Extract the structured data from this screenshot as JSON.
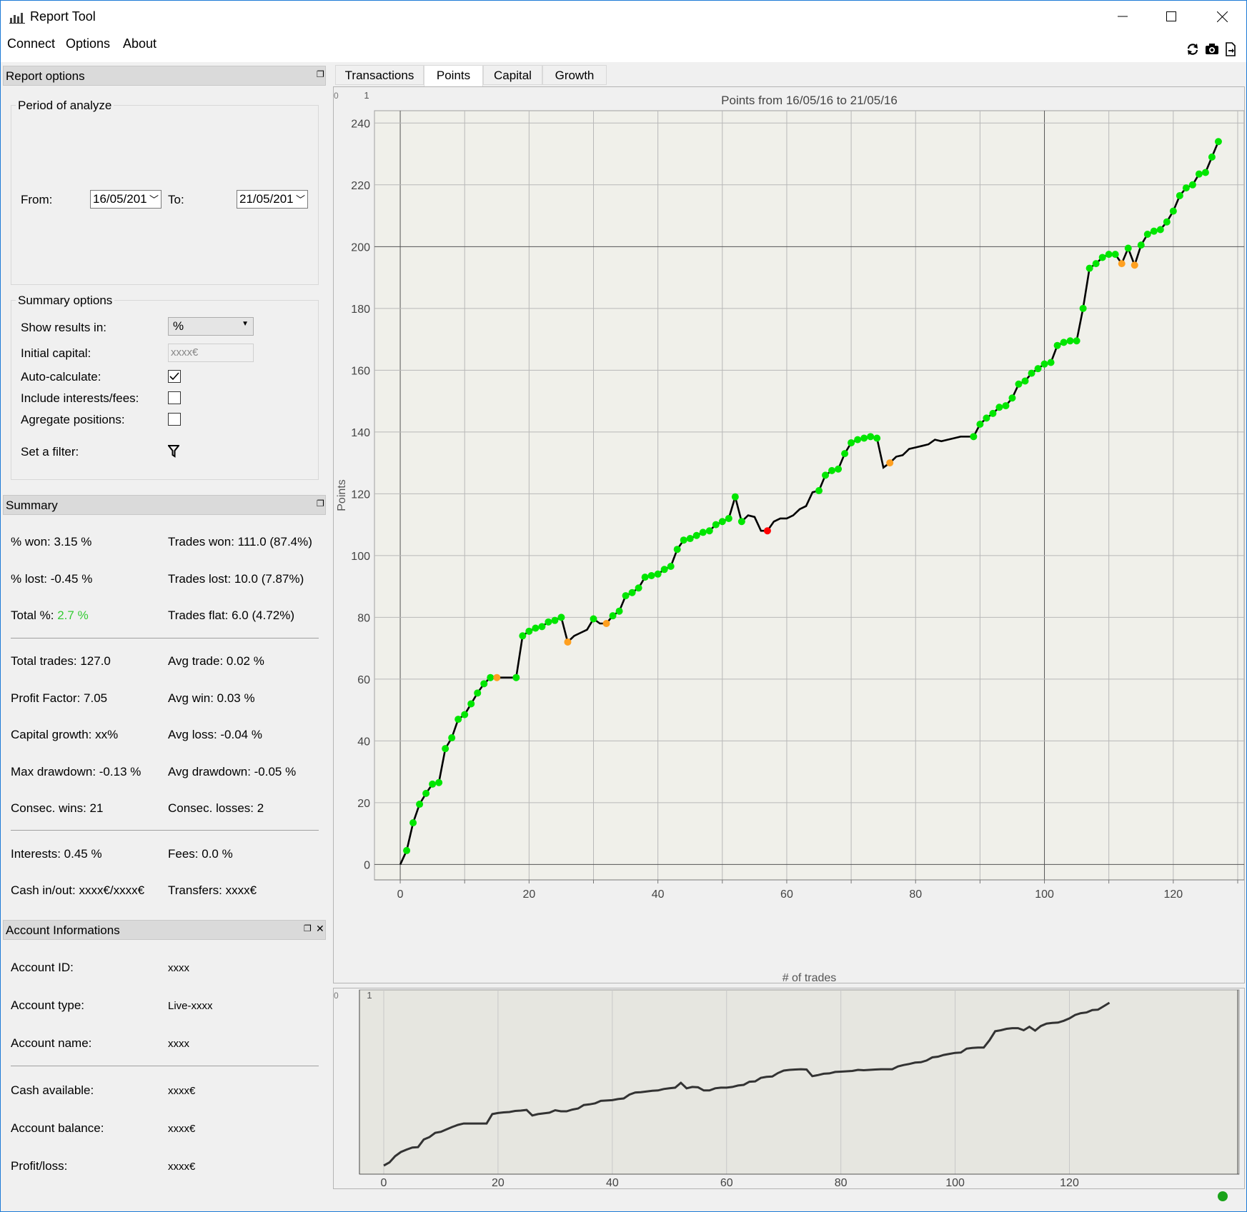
{
  "app": {
    "title": "Report Tool"
  },
  "menu": {
    "items": [
      "Connect",
      "Options",
      "About"
    ]
  },
  "toolbar": {
    "icons": [
      "refresh-icon",
      "camera-icon",
      "export-icon"
    ]
  },
  "report_options": {
    "title": "Report options",
    "period_group": "Period of analyze",
    "from_label": "From:",
    "from_value": "16/05/201",
    "to_label": "To:",
    "to_value": "21/05/201",
    "summary_group": "Summary options",
    "show_results_label": "Show results in:",
    "show_results_value": "%",
    "initial_capital_label": "Initial capital:",
    "initial_capital_placeholder": "xxxx€",
    "auto_calculate_label": "Auto-calculate:",
    "auto_calculate": true,
    "include_interests_label": "Include interests/fees:",
    "include_interests": false,
    "aggregate_label": "Agregate positions:",
    "aggregate": false,
    "filter_label": "Set a filter:"
  },
  "summary": {
    "title": "Summary",
    "won_pct_label": "% won:",
    "won_pct": "3.15 %",
    "lost_pct_label": "% lost:",
    "lost_pct": "-0.45 %",
    "total_pct_label": "Total %:",
    "total_pct": "2.7 %",
    "trades_won": "Trades won: 111.0 (87.4%)",
    "trades_lost": "Trades lost: 10.0 (7.87%)",
    "trades_flat": "Trades flat: 6.0 (4.72%)",
    "total_trades": "Total trades: 127.0",
    "avg_trade": "Avg trade: 0.02 %",
    "profit_factor": "Profit Factor: 7.05",
    "avg_win": "Avg win: 0.03 %",
    "capital_growth": "Capital growth: xx%",
    "avg_loss": "Avg loss: -0.04 %",
    "max_drawdown": "Max drawdown: -0.13 %",
    "avg_drawdown": "Avg drawdown: -0.05 %",
    "consec_wins": "Consec. wins: 21",
    "consec_losses": "Consec. losses: 2",
    "interests": "Interests: 0.45 %",
    "fees": "Fees: 0.0 %",
    "cash_inout": "Cash in/out: xxxx€/xxxx€",
    "transfers": "Transfers: xxxx€",
    "positive_color": "#33cc33"
  },
  "account": {
    "title": "Account Informations",
    "rows": [
      {
        "label": "Account ID:",
        "value": "xxxx"
      },
      {
        "label": "Account type:",
        "value": "Live-xxxx"
      },
      {
        "label": "Account name:",
        "value": "xxxx"
      },
      {
        "label": "Cash available:",
        "value": "xxxx€"
      },
      {
        "label": "Account balance:",
        "value": "xxxx€"
      },
      {
        "label": "Profit/loss:",
        "value": "xxxx€"
      }
    ]
  },
  "tabs": [
    "Transactions",
    "Points",
    "Capital",
    "Growth"
  ],
  "active_tab": "Points",
  "chart_data": {
    "type": "scatter",
    "title": "Points from 16/05/16 to 21/05/16",
    "xlabel": "# of trades",
    "ylabel": "Points",
    "xlim": [
      -4,
      131
    ],
    "ylim": [
      -5,
      244
    ],
    "xticks": [
      0,
      20,
      40,
      60,
      80,
      100,
      120
    ],
    "yticks": [
      0,
      20,
      40,
      60,
      80,
      100,
      120,
      140,
      160,
      180,
      200,
      220,
      240
    ],
    "corner_labels": [
      "0",
      "1"
    ],
    "grid": true,
    "line_color": "#000000",
    "colors": {
      "win": "#00e600",
      "flat": "#ffa020",
      "loss": "#ff0000"
    },
    "x": [
      0,
      1,
      2,
      3,
      4,
      5,
      6,
      7,
      8,
      9,
      10,
      11,
      12,
      13,
      14,
      15,
      16,
      17,
      18,
      19,
      20,
      21,
      22,
      23,
      24,
      25,
      26,
      27,
      28,
      29,
      30,
      31,
      32,
      33,
      34,
      35,
      36,
      37,
      38,
      39,
      40,
      41,
      42,
      43,
      44,
      45,
      46,
      47,
      48,
      49,
      50,
      51,
      52,
      53,
      54,
      55,
      56,
      57,
      58,
      59,
      60,
      61,
      62,
      63,
      64,
      65,
      66,
      67,
      68,
      69,
      70,
      71,
      72,
      73,
      74,
      75,
      76,
      77,
      78,
      79,
      80,
      81,
      82,
      83,
      84,
      85,
      86,
      87,
      88,
      89,
      90,
      91,
      92,
      93,
      94,
      95,
      96,
      97,
      98,
      99,
      100,
      101,
      102,
      103,
      104,
      105,
      106,
      107,
      108,
      109,
      110,
      111,
      112,
      113,
      114,
      115,
      116,
      117,
      118,
      119,
      120,
      121,
      122,
      123,
      124,
      125,
      126,
      127
    ],
    "y": [
      0,
      4.5,
      13.5,
      19.5,
      23,
      26,
      26.5,
      37.5,
      41,
      47,
      48.5,
      52,
      55.5,
      58.5,
      60.5,
      60.5,
      60.5,
      60.5,
      60.5,
      74,
      75.5,
      76.5,
      77,
      78.5,
      79,
      80,
      72,
      74,
      75,
      76,
      79.5,
      78,
      78,
      80.5,
      82,
      87,
      88,
      89.5,
      93,
      93.5,
      94,
      95.5,
      96.5,
      102,
      105,
      105.5,
      106.5,
      107.5,
      108,
      110,
      111,
      112,
      119,
      111,
      113,
      112.5,
      108,
      108,
      111,
      112,
      112,
      113,
      115,
      116,
      120.5,
      121,
      126,
      127.5,
      128,
      133,
      136.5,
      137.5,
      138,
      138.5,
      138,
      128.5,
      130,
      132,
      132.5,
      134.5,
      135,
      135.5,
      136,
      137.5,
      137,
      137.5,
      138,
      138.5,
      138.5,
      138.5,
      142.5,
      144.5,
      146,
      148,
      148.5,
      151,
      155.5,
      156.5,
      159,
      160.5,
      162,
      162.5,
      168,
      169,
      169.5,
      169.5,
      180,
      193,
      194.5,
      196.5,
      197.5,
      197.5,
      194.5,
      199.5,
      194,
      200.5,
      204,
      205,
      205.5,
      208,
      211.5,
      216.5,
      219,
      220,
      223.5,
      224,
      229,
      234
    ],
    "marker": [
      "n",
      "w",
      "w",
      "w",
      "w",
      "w",
      "w",
      "w",
      "w",
      "w",
      "w",
      "w",
      "w",
      "w",
      "w",
      "o",
      "n",
      "n",
      "w",
      "w",
      "w",
      "w",
      "w",
      "w",
      "w",
      "w",
      "o",
      "n",
      "n",
      "n",
      "w",
      "n",
      "o",
      "w",
      "w",
      "w",
      "w",
      "w",
      "w",
      "w",
      "w",
      "w",
      "w",
      "w",
      "w",
      "w",
      "w",
      "w",
      "w",
      "w",
      "w",
      "w",
      "w",
      "w",
      "n",
      "n",
      "n",
      "r",
      "n",
      "n",
      "n",
      "n",
      "n",
      "n",
      "n",
      "w",
      "w",
      "w",
      "w",
      "w",
      "w",
      "w",
      "w",
      "w",
      "w",
      "n",
      "o",
      "n",
      "n",
      "n",
      "n",
      "n",
      "n",
      "n",
      "n",
      "n",
      "n",
      "n",
      "n",
      "w",
      "w",
      "w",
      "w",
      "w",
      "w",
      "w",
      "w",
      "w",
      "w",
      "w",
      "w",
      "w",
      "w",
      "w",
      "w",
      "w",
      "w",
      "w",
      "w",
      "w",
      "w",
      "w",
      "o",
      "w",
      "o",
      "w",
      "w",
      "w",
      "w",
      "w",
      "w",
      "w",
      "w",
      "w",
      "w",
      "w",
      "w",
      "w"
    ]
  },
  "overview": {
    "xticks": [
      0,
      20,
      40,
      60,
      80,
      100,
      120
    ],
    "corner_labels": [
      "0",
      "1"
    ]
  }
}
